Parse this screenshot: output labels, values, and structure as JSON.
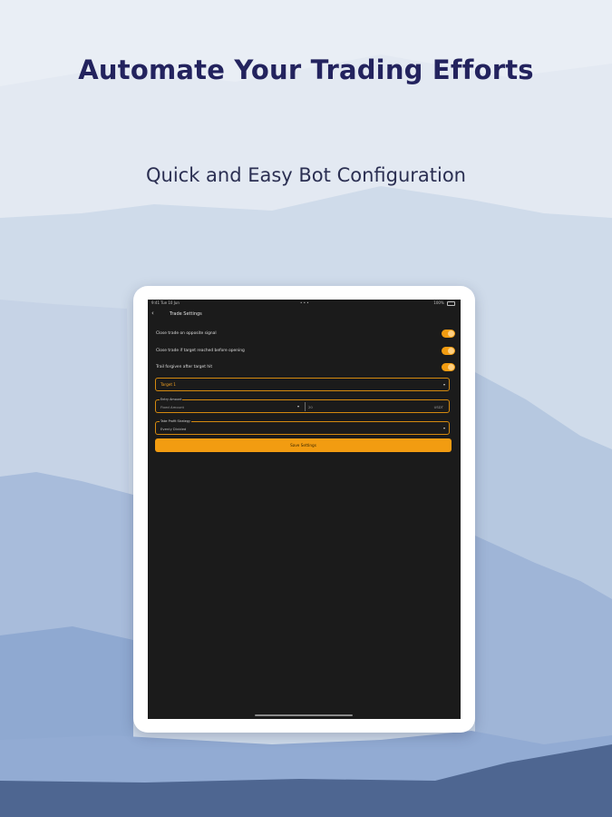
{
  "headline": "Automate Your Trading Efforts",
  "subheadline": "Quick and Easy Bot Configuration",
  "colors": {
    "accent": "#f29c11",
    "headline": "#23235e",
    "screen_bg": "#1b1b1b"
  },
  "device": {
    "status": {
      "time": "9:41 Tue 10 Jun",
      "center": "• • •",
      "battery": "100%"
    },
    "nav": {
      "back_icon": "chevron-left-icon",
      "back_glyph": "‹",
      "title": "Trade Settings"
    },
    "settings": [
      {
        "label": "Close trade on opposite signal",
        "enabled": true
      },
      {
        "label": "Close trade if target reached before opening",
        "enabled": true
      },
      {
        "label": "Trail forgiven after target hit",
        "enabled": true
      }
    ],
    "target_select": {
      "value": "Target 1",
      "caret": "▾"
    },
    "entry_field": {
      "legend": "Entry Amount",
      "placeholder": "Fixed Amount",
      "caret": "▾",
      "mid_value": "20",
      "unit": "USDT"
    },
    "tp_field": {
      "legend": "Take Profit Strategy",
      "value": "Evenly Divided",
      "caret": "▾"
    },
    "save_label": "Save Settings"
  }
}
